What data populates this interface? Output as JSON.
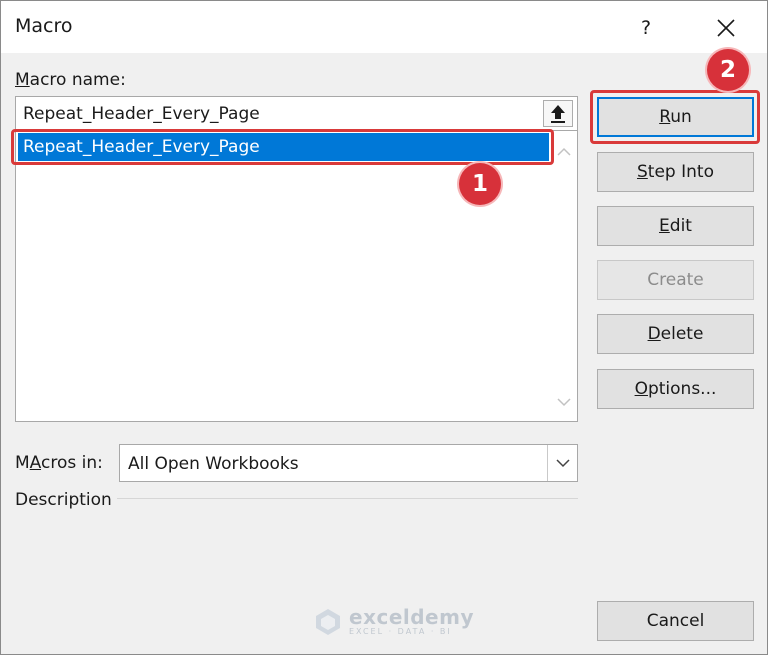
{
  "window": {
    "title": "Macro",
    "help_glyph": "?",
    "close_icon": "close-icon"
  },
  "macro_name": {
    "label_accel": "M",
    "label_rest": "acro name:",
    "value": "Repeat_Header_Every_Page",
    "upload_icon": "upload-arrow-icon"
  },
  "macro_list": {
    "items": [
      {
        "label": "Repeat_Header_Every_Page",
        "selected": true
      }
    ]
  },
  "macros_in": {
    "label_accel": "A",
    "label_before": "M",
    "label_after": "cros in:",
    "value": "All Open Workbooks"
  },
  "description": {
    "label": "Description"
  },
  "buttons": {
    "run": {
      "accel": "R",
      "rest": "un"
    },
    "step_into": {
      "accel": "S",
      "rest": "tep Into"
    },
    "edit": {
      "accel": "E",
      "rest": "dit"
    },
    "create": {
      "label": "Create"
    },
    "delete": {
      "accel": "D",
      "rest": "elete"
    },
    "options": {
      "accel": "O",
      "rest": "ptions..."
    },
    "cancel": {
      "label": "Cancel"
    }
  },
  "annotations": {
    "step1": "1",
    "step2": "2"
  },
  "watermark": {
    "name": "exceldemy",
    "tagline": "EXCEL · DATA · BI"
  },
  "colors": {
    "selection": "#0078d7",
    "annotation_red": "#d93a3a",
    "dialog_bg": "#f0f0f0"
  }
}
